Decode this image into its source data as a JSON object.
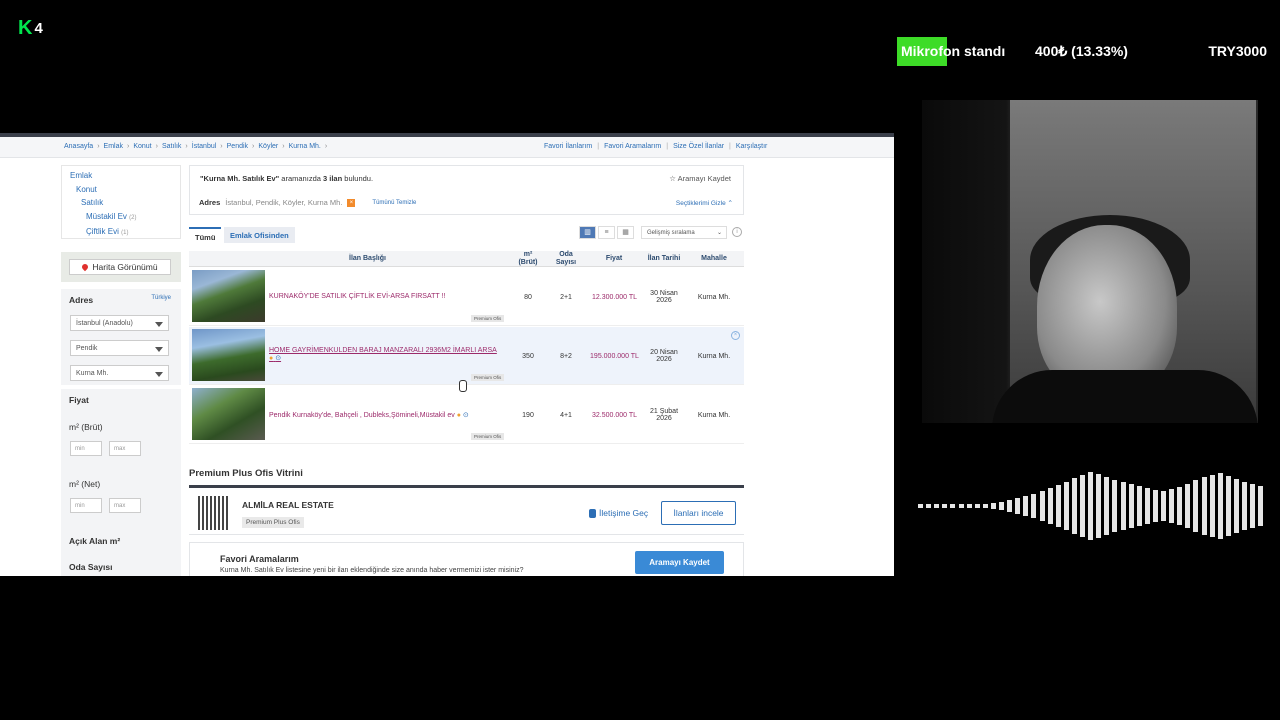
{
  "overlay": {
    "logo_k": "K",
    "logo_num": "4",
    "ticker": {
      "label": "Mikrofon standı",
      "amount": "400₺ (13.33%)",
      "goal": "TRY3000",
      "progress_pct": 13.33,
      "progress_color": "#3ddc27"
    }
  },
  "breadcrumb": [
    "Anasayfa",
    "Emlak",
    "Konut",
    "Satılık",
    "İstanbul",
    "Pendik",
    "Köyler",
    "Kurna Mh."
  ],
  "top_links": [
    "Favori İlanlarım",
    "Favori Aramalarım",
    "Size Özel İlanlar",
    "Karşılaştır"
  ],
  "sidebar": {
    "categories": [
      {
        "label": "Emlak",
        "count": ""
      },
      {
        "label": "Konut",
        "count": ""
      },
      {
        "label": "Satılık",
        "count": ""
      },
      {
        "label": "Müstakil Ev",
        "count": "(2)"
      },
      {
        "label": "Çiftlik Evi",
        "count": "(1)"
      }
    ],
    "map_button": "Harita Görünümü",
    "address_title": "Adres",
    "address_country": "Türkiye",
    "selects": [
      "İstanbul (Anadolu)",
      "Pendik",
      "Kurna Mh."
    ],
    "price_title": "Fiyat",
    "gross_title": "m² (Brüt)",
    "net_title": "m² (Net)",
    "min_placeholder": "min",
    "max_placeholder": "max",
    "open_area_title": "Açık Alan m²",
    "rooms_title": "Oda Sayısı"
  },
  "results": {
    "query": "\"Kurna Mh. Satılık Ev\"",
    "mid": " aramanızda ",
    "count": "3 ilan",
    "tail": " bulundu.",
    "save_search": "☆ Aramayı Kaydet",
    "address_label": "Adres",
    "address_value": "İstanbul, Pendik, Köyler, Kurna Mh.",
    "clear_all": "Tümünü Temizle",
    "hide_selected": "Seçtiklerimi Gizle ⌃"
  },
  "tabs": {
    "all": "Tümü",
    "office": "Emlak Ofisinden"
  },
  "sort": "Gelişmiş sıralama",
  "table": {
    "headers": {
      "title": "İlan Başlığı",
      "area": "m²",
      "area2": "(Brüt)",
      "rooms": "Oda",
      "rooms2": "Sayısı",
      "price": "Fiyat",
      "date": "İlan Tarihi",
      "district": "Mahalle"
    },
    "rows": [
      {
        "title": "KURNAKÖY'DE SATILIK ÇİFTLİK EVİ-ARSA FIRSATT !!",
        "badge": "Premium Ofis",
        "area": "80",
        "rooms": "2+1",
        "price": "12.300.000 TL",
        "date1": "30 Nisan",
        "date2": "2026",
        "district": "Kurna Mh."
      },
      {
        "title": "HOME GAYRİMENKULDEN BARAJ MANZARALI 2936M2 İMARLI ARSA",
        "badge": "Premium Ofis",
        "area": "350",
        "rooms": "8+2",
        "price": "195.000.000 TL",
        "date1": "20 Nisan",
        "date2": "2026",
        "district": "Kurna Mh."
      },
      {
        "title": "Pendik Kurnaköy'de, Bahçeli , Dubleks,Şömineli,Müstakil ev",
        "badge": "Premium Ofis",
        "area": "190",
        "rooms": "4+1",
        "price": "32.500.000 TL",
        "date1": "21 Şubat",
        "date2": "2026",
        "district": "Kurna Mh."
      }
    ]
  },
  "vitrin": {
    "heading": "Premium Plus Ofis Vitrini",
    "office_name": "ALMİLA REAL ESTATE",
    "office_badge": "Premium Plus Ofis",
    "contact": "İletişime Geç",
    "listings": "İlanları incele"
  },
  "favorites": {
    "title": "Favori Aramalarım",
    "desc": "Kurna Mh. Satılık Ev listesine yeni bir ilan eklendiğinde size anında haber vermemizi ister misiniz?",
    "button": "Aramayı Kaydet"
  },
  "colors": {
    "accent": "#2c6eb5",
    "listing_title": "#9c2a6a",
    "primary_button": "#3a8ad6"
  }
}
